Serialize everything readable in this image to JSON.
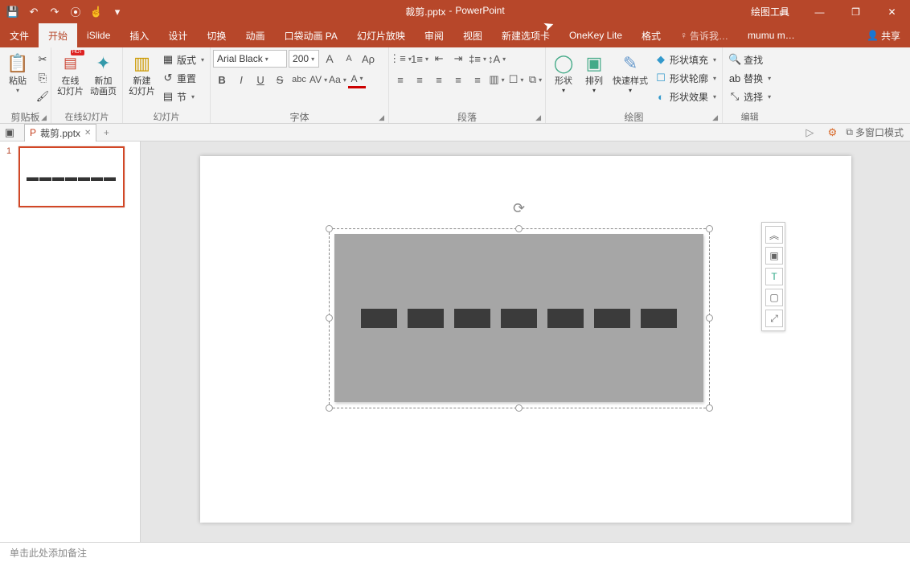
{
  "qat": {
    "save": "💾",
    "undo": "↶",
    "redo": "↷",
    "start": "⦿",
    "touch": "☝",
    "more": "▾"
  },
  "title": {
    "file": "裁剪.pptx",
    "app": "PowerPoint"
  },
  "drawing_tools": "绘图工具",
  "win": {
    "opts": "▭",
    "min": "—",
    "restore": "❐",
    "close": "✕"
  },
  "tabs": {
    "file": "文件",
    "home": "开始",
    "islide": "iSlide",
    "insert": "插入",
    "design": "设计",
    "transitions": "切换",
    "animations": "动画",
    "pocket": "口袋动画 PA",
    "slideshow": "幻灯片放映",
    "review": "审阅",
    "view": "视图",
    "newtab": "新建选项卡",
    "onekey": "OneKey Lite",
    "format": "格式",
    "tellme_prefix": "告诉我…",
    "user": "mumu m…",
    "share": "共享"
  },
  "groups": {
    "clipboard": {
      "label": "剪贴板",
      "paste": "粘贴",
      "cut": "✂",
      "copy": "⎘",
      "painter": "🖌"
    },
    "onlineslides": {
      "label": "在线幻灯片",
      "online": "在线\n幻灯片",
      "newanim": "新加\n动画页"
    },
    "slides": {
      "label": "幻灯片",
      "newslide": "新建\n幻灯片",
      "layout": "版式",
      "reset": "重置",
      "section": "节"
    },
    "font": {
      "label": "字体",
      "name": "Arial Black",
      "size": "200",
      "grow": "A",
      "shrink": "A",
      "clear": "Aρ",
      "bold": "B",
      "italic": "I",
      "underline": "U",
      "strike": "S",
      "shadow": "abc",
      "spacing": "AV",
      "case": "Aa",
      "fontcolor": "A"
    },
    "paragraph": {
      "label": "段落"
    },
    "drawing": {
      "label": "绘图",
      "shapes": "形状",
      "arrange": "排列",
      "quick": "快速样式",
      "fill": "形状填充",
      "outline": "形状轮廓",
      "effects": "形状效果"
    },
    "editing": {
      "label": "编辑",
      "find": "查找",
      "replace": "替换",
      "select": "选择"
    }
  },
  "doctab": {
    "name": "裁剪.pptx",
    "multiwindow": "多窗口模式"
  },
  "thumb": {
    "num": "1",
    "text": "▬▬▬▬▬▬▬"
  },
  "notes_placeholder": "单击此处添加备注"
}
